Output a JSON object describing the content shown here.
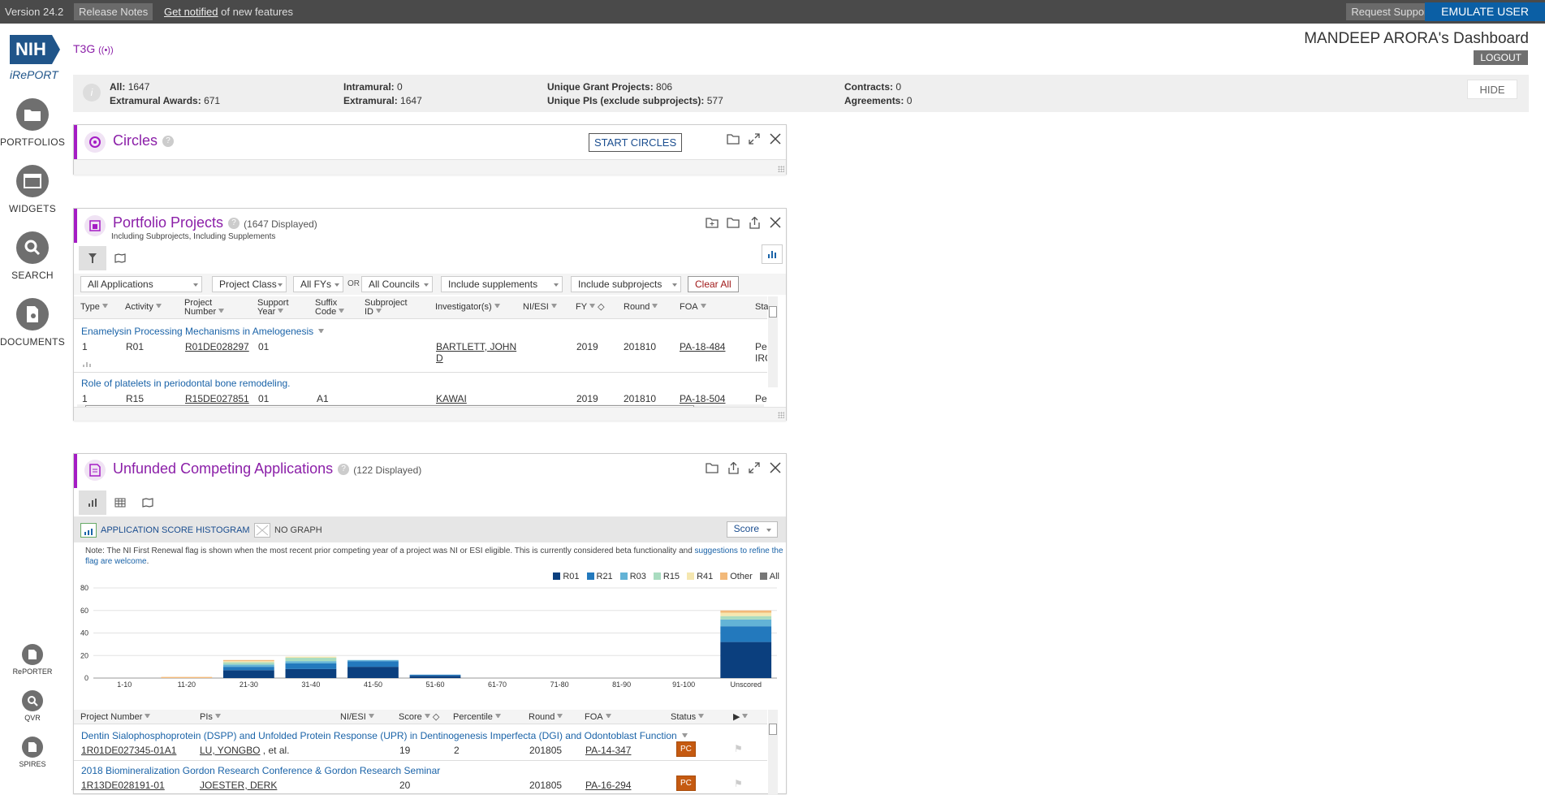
{
  "topbar": {
    "version": "Version 24.2",
    "release_notes": "Release Notes",
    "get_notified": "Get notified",
    "notified_suffix": " of new features",
    "request_support": "Request Support",
    "emulate_user": "EMULATE USER"
  },
  "logo": {
    "nih": "NIH",
    "ireport": "iRePORT"
  },
  "nav": {
    "portfolios": "PORTFOLIOS",
    "widgets": "WIDGETS",
    "search": "SEARCH",
    "documents": "DOCUMENTS",
    "reporter": "RePORTER",
    "qvr": "QVR",
    "spires": "SPIRES"
  },
  "header": {
    "t3g": "T3G",
    "dashboard_title": "MANDEEP ARORA's Dashboard",
    "logout": "LOGOUT"
  },
  "summary": {
    "all_label": "All:",
    "all_value": "1647",
    "extramural_awards_label": "Extramural Awards:",
    "extramural_awards_value": "671",
    "intramural_label": "Intramural:",
    "intramural_value": "0",
    "extramural_label": "Extramural:",
    "extramural_value": "1647",
    "unique_grants_label": "Unique Grant Projects:",
    "unique_grants_value": "806",
    "unique_pis_label": "Unique PIs (exclude subprojects):",
    "unique_pis_value": "577",
    "contracts_label": "Contracts:",
    "contracts_value": "0",
    "agreements_label": "Agreements:",
    "agreements_value": "0",
    "hide": "HIDE"
  },
  "circles": {
    "title": "Circles",
    "start_button": "START CIRCLES"
  },
  "portfolio": {
    "title": "Portfolio Projects",
    "count": "(1647 Displayed)",
    "subtitle": "Including Subprojects, Including Supplements",
    "filters": {
      "applications": "All Applications",
      "project_class": "Project Class",
      "fys": "All FYs",
      "or": "OR",
      "councils": "All Councils",
      "supplements": "Include supplements",
      "subprojects": "Include subprojects",
      "clear_all": "Clear All"
    },
    "columns": [
      "Type",
      "Activity",
      "Project Number",
      "Support Year",
      "Suffix Code",
      "Subproject ID",
      "Investigator(s)",
      "NI/ESI",
      "FY",
      "Round",
      "FOA",
      "Sta"
    ],
    "rows": [
      {
        "title": "Enamelysin Processing Mechanisms in Amelogenesis",
        "type": "1",
        "activity": "R01",
        "project_number": "R01DE028297",
        "support_year": "01",
        "suffix": "",
        "investigator": "BARTLETT, JOHN D",
        "fy": "2019",
        "round": "201810",
        "foa": "PA-18-484",
        "status": "Pe IRC"
      },
      {
        "title": "Role of platelets in periodontal bone remodeling.",
        "type": "1",
        "activity": "R15",
        "project_number": "R15DE027851",
        "support_year": "01",
        "suffix": "A1",
        "investigator": "KAWAI",
        "fy": "2019",
        "round": "201810",
        "foa": "PA-18-504",
        "status": "Pe"
      }
    ]
  },
  "unfunded": {
    "title": "Unfunded Competing Applications",
    "count": "(122 Displayed)",
    "histogram_label": "APPLICATION SCORE HISTOGRAM",
    "no_graph_label": "NO GRAPH",
    "score_dropdown": "Score",
    "note": "Note: The NI First Renewal flag is shown when the most recent prior competing year of a project was NI or ESI eligible. This is currently considered beta functionality and",
    "note_link": "suggestions to refine the flag are welcome",
    "note_end": ".",
    "columns": [
      "Project Number",
      "PIs",
      "NI/ESI",
      "Score",
      "Percentile",
      "Round",
      "FOA",
      "Status"
    ],
    "rows": [
      {
        "title": "Dentin Sialophosphoprotein (DSPP) and Unfolded Protein Response (UPR) in Dentinogenesis Imperfecta (DGI) and Odontoblast Function",
        "project_number": "1R01DE027345-01A1",
        "pi": "LU, YONGBO",
        "pi_suffix": " , et al.",
        "score": "19",
        "percentile": "2",
        "round": "201805",
        "foa": "PA-14-347",
        "status": "PC"
      },
      {
        "title": "2018 Biomineralization Gordon Research Conference & Gordon Research Seminar",
        "project_number": "1R13DE028191-01",
        "pi": "JOESTER, DERK",
        "pi_suffix": "",
        "score": "20",
        "percentile": "",
        "round": "201805",
        "foa": "PA-16-294",
        "status": "PC"
      }
    ]
  },
  "colors": {
    "accent": "#a41cc4",
    "R01": "#0b3f7e",
    "R21": "#2379bd",
    "R03": "#63b3d6",
    "R15": "#a9dcc0",
    "R41": "#f5e7b0",
    "Other": "#f2b97a",
    "All": "#777777"
  },
  "chart_data": {
    "type": "bar",
    "stacked": true,
    "categories": [
      "1-10",
      "11-20",
      "21-30",
      "31-40",
      "41-50",
      "51-60",
      "61-70",
      "71-80",
      "81-90",
      "91-100",
      "Unscored"
    ],
    "series": [
      {
        "name": "R01",
        "values": [
          0,
          0,
          7,
          8,
          10,
          2,
          0,
          0,
          0,
          0,
          32
        ]
      },
      {
        "name": "R21",
        "values": [
          0,
          0,
          3,
          5,
          5,
          1,
          0,
          0,
          0,
          0,
          14
        ]
      },
      {
        "name": "R03",
        "values": [
          0,
          0,
          2,
          2,
          1,
          0,
          0,
          0,
          0,
          0,
          6
        ]
      },
      {
        "name": "R15",
        "values": [
          0,
          0,
          2,
          3,
          0,
          0,
          0,
          0,
          0,
          0,
          3
        ]
      },
      {
        "name": "R41",
        "values": [
          0,
          0,
          1,
          1,
          0,
          0,
          0,
          0,
          0,
          0,
          3
        ]
      },
      {
        "name": "Other",
        "values": [
          0,
          1,
          1,
          0,
          0,
          0,
          0,
          0,
          0,
          0,
          2
        ]
      },
      {
        "name": "All",
        "values": [
          0,
          0,
          0,
          0,
          0,
          0,
          0,
          0,
          0,
          0,
          0
        ]
      }
    ],
    "ylim": [
      0,
      80
    ],
    "yticks": [
      0,
      20,
      40,
      60,
      80
    ],
    "legend": "top-right",
    "grid": true
  }
}
